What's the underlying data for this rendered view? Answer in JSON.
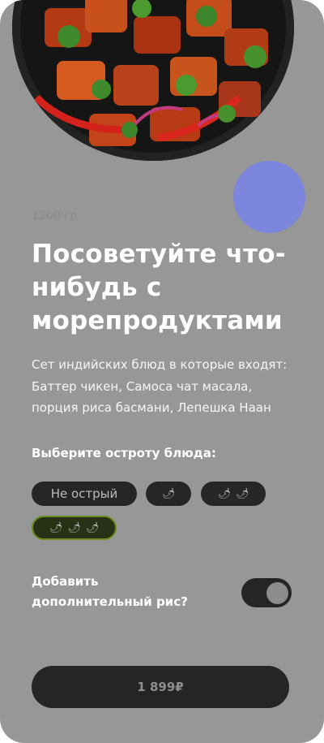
{
  "product": {
    "weight": "1200 гр",
    "title": "Посоветуйте что-нибудь с морепродуктами",
    "description": "Сет индийских блюд в которые входят: Баттер чикен, Самоса чат масала, порция риса басмани, Лепешка Наан"
  },
  "spice": {
    "label": "Выберите остроту блюда:",
    "options": [
      {
        "label": "Не острый",
        "peppers": 0
      },
      {
        "label": "",
        "peppers": 1
      },
      {
        "label": "",
        "peppers": 2
      },
      {
        "label": "",
        "peppers": 3,
        "selected": true
      }
    ],
    "pepper_glyph": "🌶"
  },
  "rice": {
    "label": "Добавить дополнительный рис?",
    "toggle_on": true
  },
  "checkout": {
    "price_label": "1 899₽"
  },
  "colors": {
    "card_bg": "#979797",
    "accent_circle": "#7b86dc",
    "chip_bg": "#262626",
    "chip_selected_border": "#6a8c1d",
    "button_bg": "#252525"
  },
  "icons": {
    "pepper": "chili-pepper-icon",
    "toggle": "toggle-switch"
  }
}
